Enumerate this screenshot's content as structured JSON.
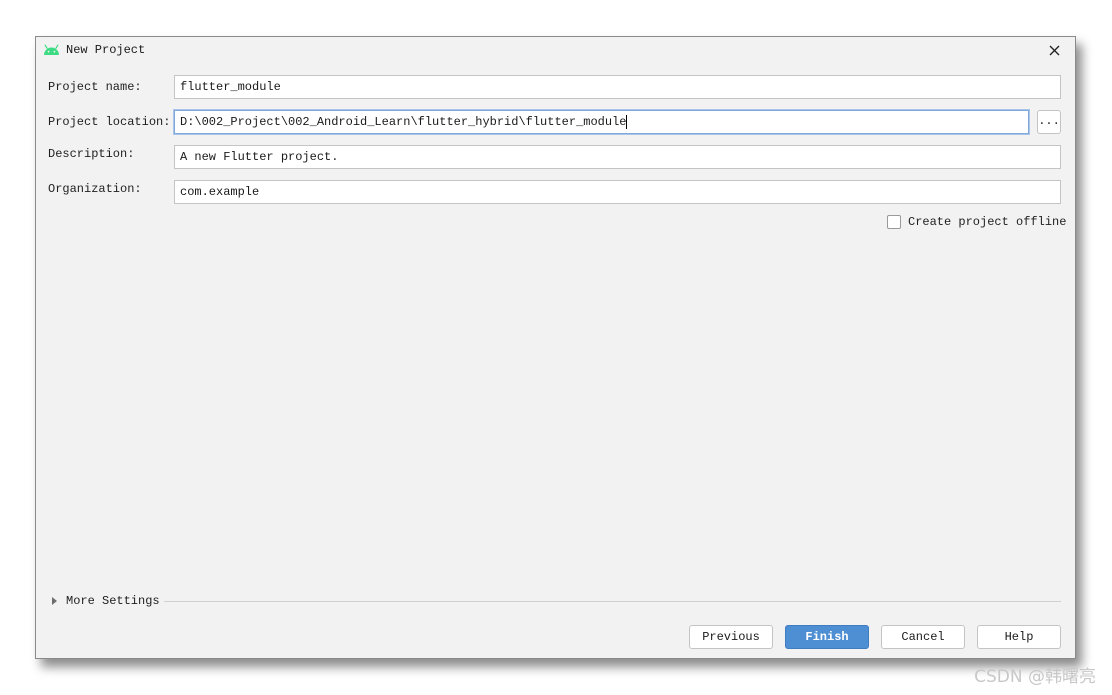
{
  "window": {
    "title": "New Project",
    "app_icon": "android-icon",
    "close_icon": "close-icon"
  },
  "form": {
    "project_name": {
      "label": "Project name:",
      "value": "flutter_module"
    },
    "project_location": {
      "label": "Project location:",
      "value": "D:\\002_Project\\002_Android_Learn\\flutter_hybrid\\flutter_module",
      "browse_label": "..."
    },
    "description": {
      "label": "Description:",
      "value": "A new Flutter project."
    },
    "organization": {
      "label": "Organization:",
      "value": "com.example"
    },
    "offline": {
      "label": "Create project offline",
      "checked": false
    }
  },
  "more_settings": {
    "label": "More Settings",
    "expanded": false
  },
  "buttons": {
    "previous": "Previous",
    "finish": "Finish",
    "cancel": "Cancel",
    "help": "Help"
  },
  "watermark": "CSDN @韩曙亮",
  "colors": {
    "primary_button": "#4e8fd4",
    "android_green": "#3ddc84",
    "focus_border": "#7ea8d8"
  }
}
